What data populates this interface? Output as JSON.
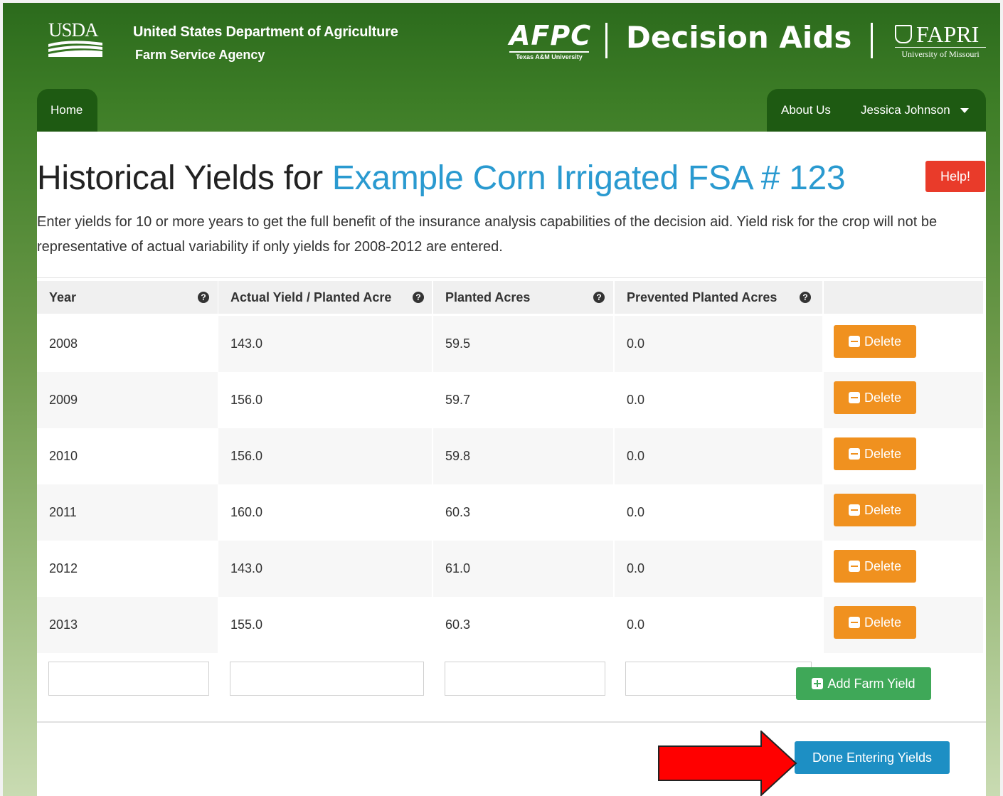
{
  "header": {
    "usda_logo_text": "USDA",
    "department": "United States Department of Agriculture",
    "agency": "Farm Service Agency",
    "afpc_logo": "AFPC",
    "afpc_sub": "Texas A&M University",
    "app_title": "Decision Aids",
    "fapri_logo": "FAPRI",
    "fapri_sub": "University of Missouri"
  },
  "nav": {
    "home": "Home",
    "about": "About Us",
    "user": "Jessica Johnson"
  },
  "page": {
    "title_prefix": "Historical Yields for",
    "title_highlight": "Example Corn Irrigated FSA # 123",
    "help_label": "Help!",
    "intro": "Enter yields for 10 or more years to get the full benefit of the insurance analysis capabilities of the decision aid. Yield risk for the crop will not be representative of actual variability if only yields for 2008-2012 are entered."
  },
  "table": {
    "headers": [
      "Year",
      "Actual Yield / Planted Acre",
      "Planted Acres",
      "Prevented Planted Acres"
    ],
    "rows": [
      {
        "year": "2008",
        "yield": "143.0",
        "planted": "59.5",
        "prevented": "0.0"
      },
      {
        "year": "2009",
        "yield": "156.0",
        "planted": "59.7",
        "prevented": "0.0"
      },
      {
        "year": "2010",
        "yield": "156.0",
        "planted": "59.8",
        "prevented": "0.0"
      },
      {
        "year": "2011",
        "yield": "160.0",
        "planted": "60.3",
        "prevented": "0.0"
      },
      {
        "year": "2012",
        "yield": "143.0",
        "planted": "61.0",
        "prevented": "0.0"
      },
      {
        "year": "2013",
        "yield": "155.0",
        "planted": "60.3",
        "prevented": "0.0"
      }
    ],
    "delete_label": "Delete",
    "add_label": "Add Farm Yield",
    "help_icon_glyph": "?"
  },
  "actions": {
    "done_label": "Done Entering Yields"
  },
  "colors": {
    "accent_blue": "#2a9ad0",
    "delete_orange": "#f0911f",
    "add_green": "#3fa858",
    "done_blue": "#1d8fc4",
    "help_red": "#e93b2a",
    "arrow_red": "#ff0000"
  },
  "icons": {
    "question": "question-circle-icon",
    "minus": "minus-square-icon",
    "plus": "plus-square-icon",
    "caret": "caret-down-icon",
    "arrow": "red-arrow-icon"
  }
}
